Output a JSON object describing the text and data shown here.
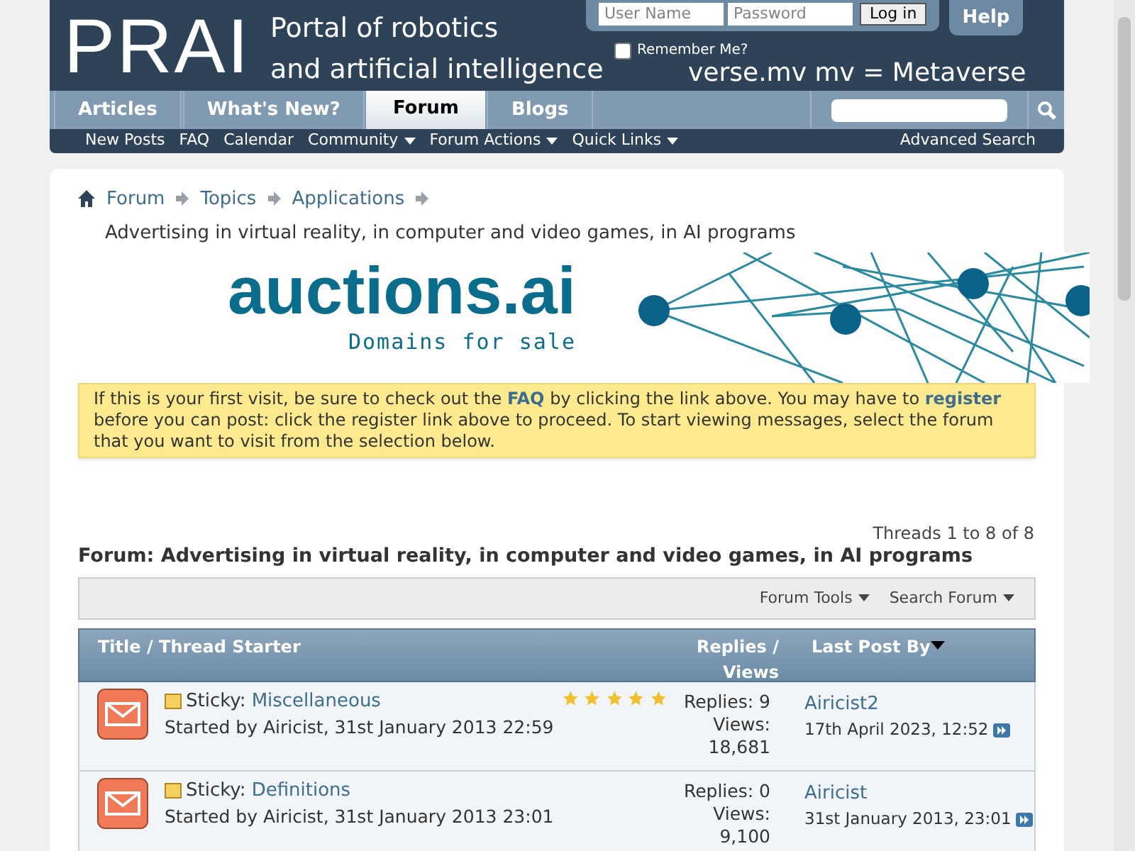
{
  "header": {
    "logo": "PRAI",
    "tagline": [
      "Portal of robotics",
      "and artificial intelligence"
    ],
    "login": {
      "username_placeholder": "User Name",
      "password_placeholder": "Password",
      "button": "Log in",
      "remember": {
        "label": "Remember Me?",
        "checked": false
      }
    },
    "help": "Help",
    "ticker": "verse.mv mv = Metaverse"
  },
  "tabs": [
    {
      "label": "Articles",
      "selected": false
    },
    {
      "label": "What's New?",
      "selected": false
    },
    {
      "label": "Forum",
      "selected": true
    },
    {
      "label": "Blogs",
      "selected": false
    }
  ],
  "subnav": {
    "items": [
      {
        "label": "New Posts",
        "has_menu": false
      },
      {
        "label": "FAQ",
        "has_menu": false
      },
      {
        "label": "Calendar",
        "has_menu": false
      },
      {
        "label": "Community",
        "has_menu": true
      },
      {
        "label": "Forum Actions",
        "has_menu": true
      },
      {
        "label": "Quick Links",
        "has_menu": true
      }
    ],
    "advanced_search": "Advanced Search"
  },
  "breadcrumb": {
    "items": [
      "Forum",
      "Topics",
      "Applications"
    ],
    "current": "Advertising in virtual reality, in computer and video games, in AI programs"
  },
  "banner": {
    "brand": "auctions.ai",
    "tagline": "Domains for sale"
  },
  "notice": [
    {
      "kind": "text",
      "text": "If this is your first visit, be sure to check out the"
    },
    {
      "kind": "link",
      "text": "FAQ"
    },
    {
      "kind": "text",
      "text": "by clicking the link above. You may have to"
    },
    {
      "kind": "link",
      "text": "register"
    },
    {
      "kind": "text",
      "text": "before you can post: click the register link above to proceed. To start viewing messages, select the forum that you want to visit from the selection below."
    }
  ],
  "forum": {
    "thread_count": "Threads 1 to 8 of 8",
    "title": "Forum: Advertising in virtual reality, in computer and video games, in AI programs",
    "tools": [
      "Forum Tools",
      "Search Forum"
    ],
    "columns": [
      "Title / Thread Starter",
      "Replies / Views",
      "Last Post By"
    ],
    "rows": [
      {
        "prefix": "Sticky:",
        "title": "Miscellaneous",
        "starter": "Started by Airicist, 31st January 2013 22:59",
        "stars": 5,
        "replies": "Replies: 9",
        "views_label": "Views:",
        "views": "18,681",
        "last_user": "Airicist2",
        "last_date": "17th April 2023, 12:52"
      },
      {
        "prefix": "Sticky:",
        "title": "Definitions",
        "starter": "Started by Airicist, 31st January 2013 23:01",
        "replies": "Replies: 0",
        "views_label": "Views:",
        "views": "9,100",
        "last_user": "Airicist",
        "last_date": "31st January 2013, 23:01"
      }
    ]
  }
}
